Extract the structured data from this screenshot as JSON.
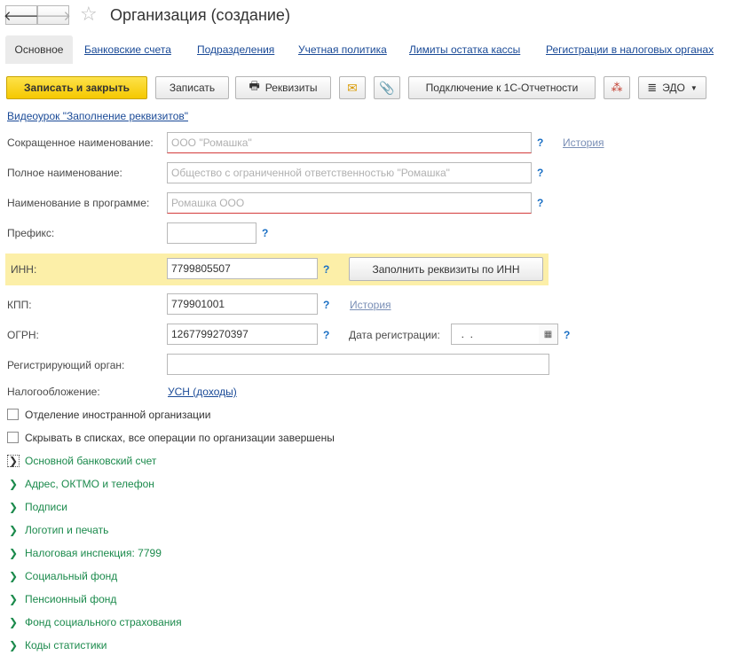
{
  "header": {
    "title": "Организация (создание)",
    "back_glyph": "🡐",
    "forward_glyph": "🡒",
    "star_glyph": "☆"
  },
  "tabs": [
    {
      "label": "Основное"
    },
    {
      "label": "Банковские счета"
    },
    {
      "label": "Подразделения"
    },
    {
      "label": "Учетная политика"
    },
    {
      "label": "Лимиты остатка кассы"
    },
    {
      "label": "Регистрации в налоговых органах"
    }
  ],
  "toolbar": {
    "save_close": "Записать и закрыть",
    "save": "Записать",
    "details": "Реквизиты",
    "connect": "Подключение к 1С-Отчетности",
    "edo": "ЭДО"
  },
  "video_link": "Видеоурок \"Заполнение реквизитов\"",
  "form": {
    "short_name": {
      "label": "Сокращенное наименование:",
      "placeholder": "ООО \"Ромашка\"",
      "value": ""
    },
    "full_name": {
      "label": "Полное наименование:",
      "placeholder": "Общество с ограниченной ответственностью \"Ромашка\"",
      "value": ""
    },
    "program_name": {
      "label": "Наименование в программе:",
      "placeholder": "Ромашка ООО",
      "value": ""
    },
    "prefix": {
      "label": "Префикс:",
      "value": ""
    },
    "inn": {
      "label": "ИНН:",
      "value": "7799805507"
    },
    "kpp": {
      "label": "КПП:",
      "value": "779901001"
    },
    "ogrn": {
      "label": "ОГРН:",
      "value": "1267799270397"
    },
    "reg_date": {
      "label": "Дата регистрации:",
      "value": "  .  ."
    },
    "reg_authority": {
      "label": "Регистрирующий орган:",
      "value": ""
    },
    "taxation": {
      "label": "Налогообложение:",
      "value": "УСН (доходы)"
    },
    "fill_by_inn": "Заполнить реквизиты по ИНН",
    "history": "История",
    "help": "?"
  },
  "checkboxes": [
    {
      "label": "Отделение иностранной организации",
      "checked": false
    },
    {
      "label": "Скрывать в списках, все операции по организации завершены",
      "checked": false
    }
  ],
  "groups": [
    {
      "label": "Основной банковский счет"
    },
    {
      "label": "Адрес, ОКТМО и телефон"
    },
    {
      "label": "Подписи"
    },
    {
      "label": "Логотип и печать"
    },
    {
      "label": "Налоговая инспекция: 7799"
    },
    {
      "label": "Социальный фонд"
    },
    {
      "label": "Пенсионный фонд"
    },
    {
      "label": "Фонд социального страхования"
    },
    {
      "label": "Коды статистики"
    }
  ],
  "colors": {
    "primary_button": "#f5c800",
    "link": "#1a4a97",
    "group_green": "#1b8a4c",
    "inn_highlight": "#fcefa8"
  }
}
